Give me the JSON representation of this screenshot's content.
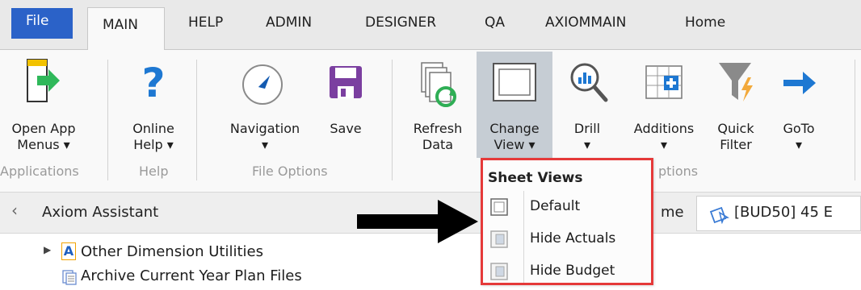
{
  "tabs": {
    "file": "File",
    "main": "MAIN",
    "help": "HELP",
    "admin": "ADMIN",
    "designer": "DESIGNER",
    "qa": "QA",
    "axiommain": "AXIOMMAIN",
    "home": "Home"
  },
  "ribbon": {
    "open_app_menus": "Open App\nMenus ▾",
    "online_help": "Online\nHelp ▾",
    "navigation": "Navigation\n▾",
    "save": "Save",
    "refresh_data": "Refresh\nData",
    "change_view": "Change\nView ▾",
    "drill": "Drill\n▾",
    "additions": "Additions\n▾",
    "quick_filter": "Quick\nFilter",
    "goto": "GoTo\n▾",
    "groups": {
      "applications": "Applications",
      "help": "Help",
      "file_options": "File Options",
      "options_partial": "ptions"
    }
  },
  "assistant": {
    "arrow": "‹",
    "title": "Axiom Assistant",
    "home_partial": "me",
    "doc_tab": "[BUD50] 45 E"
  },
  "tree": {
    "item1": "Other Dimension Utilities",
    "item2": "Archive Current Year Plan Files"
  },
  "menu": {
    "title": "Sheet Views",
    "items": [
      "Default",
      "Hide Actuals",
      "Hide Budget"
    ]
  },
  "colors": {
    "file_tab": "#2b62c8",
    "menu_border": "#e53939",
    "ribbon_icon_blue": "#1e78d2",
    "save_purple": "#7b3fa0",
    "arrow_green": "#2fb85a"
  }
}
